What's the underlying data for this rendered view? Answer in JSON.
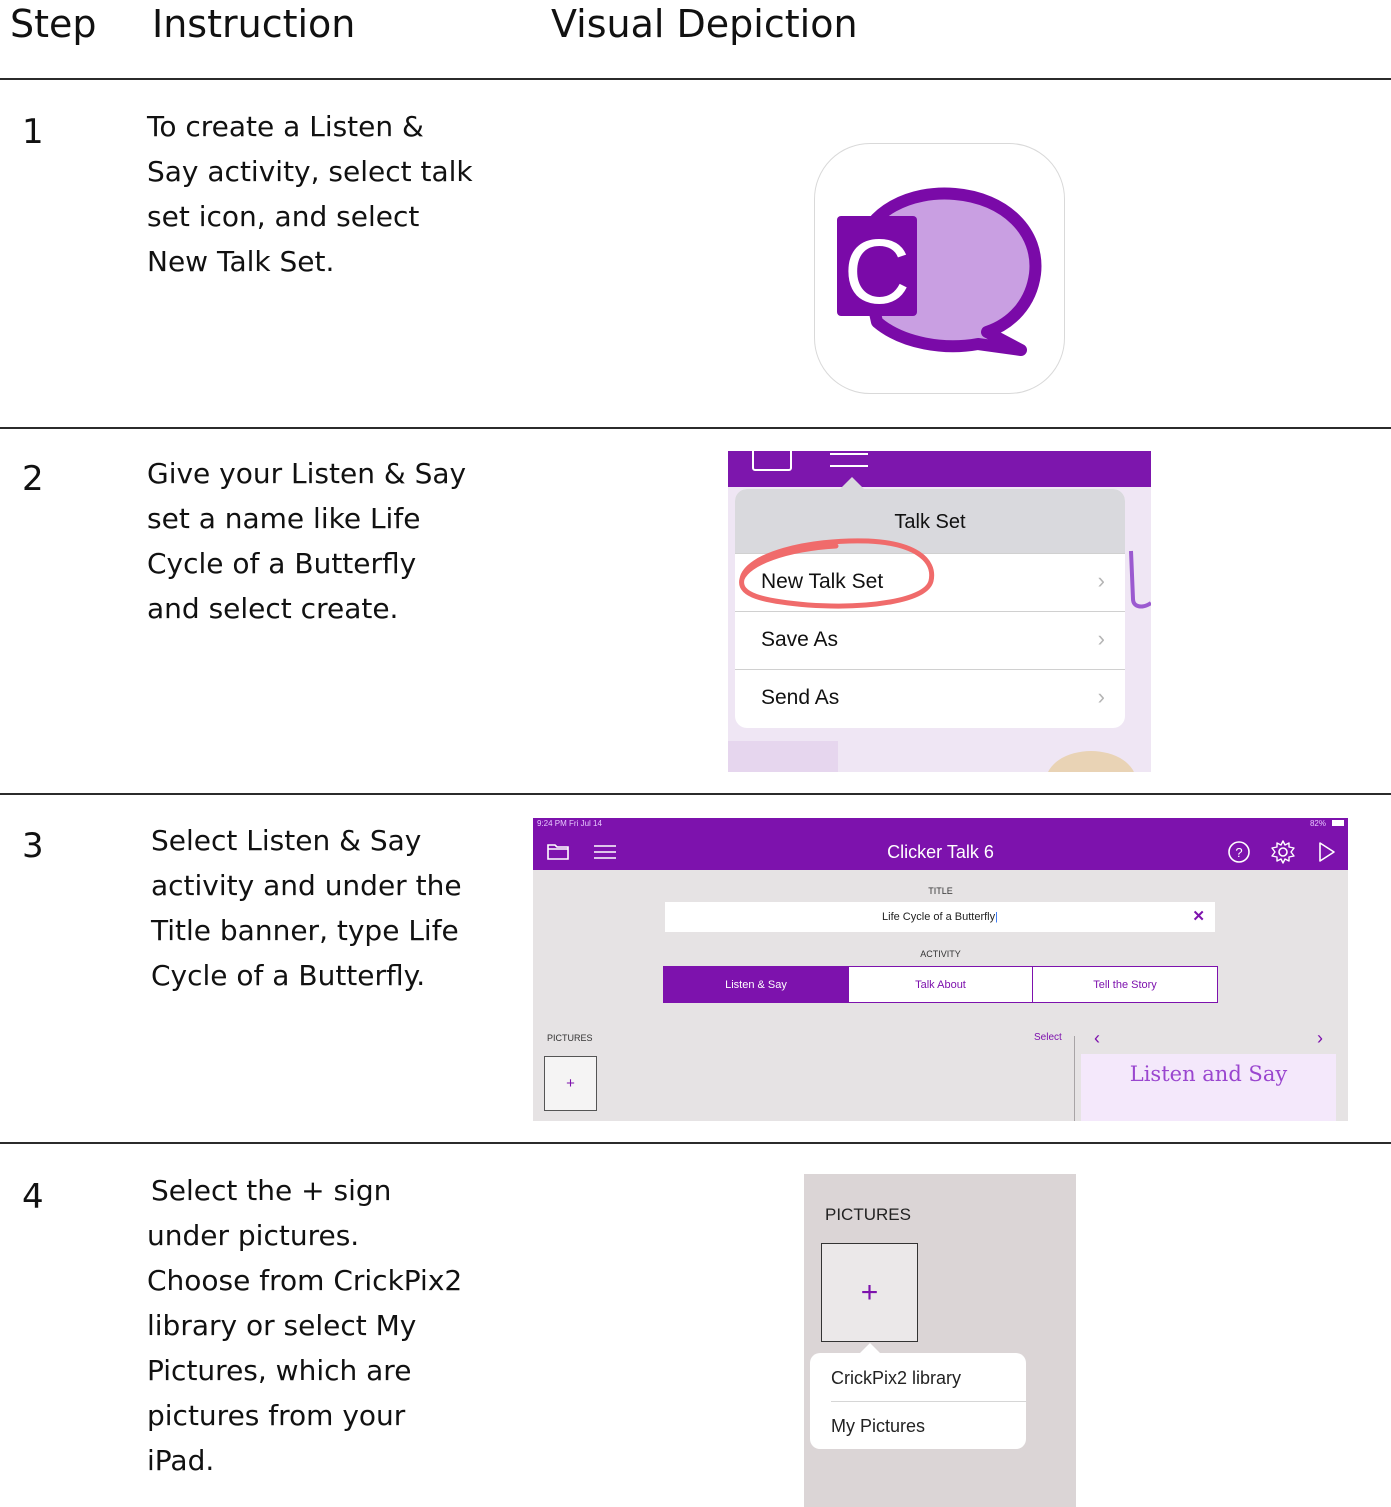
{
  "headers": {
    "step": "Step",
    "instruction": "Instruction",
    "visual": "Visual Depiction"
  },
  "rows": [
    {
      "step": "1",
      "lines": [
        "To create a Listen &",
        "Say activity, select talk",
        "set icon, and select",
        "New Talk Set."
      ]
    },
    {
      "step": "2",
      "lines": [
        "Give your Listen & Say",
        "set a name like Life",
        "Cycle of a Butterfly",
        "and select create."
      ]
    },
    {
      "step": "3",
      "lines": [
        "Select Listen & Say",
        "activity and under the",
        "Title banner, type Life",
        "Cycle of a Butterfly."
      ]
    },
    {
      "step": "4",
      "lines": [
        "Select the + sign",
        "under pictures.",
        "Choose from CrickPix2",
        "library or select My",
        "Pictures, which are",
        "pictures from your",
        "iPad."
      ]
    }
  ],
  "menu": {
    "header": "Talk Set",
    "items": [
      "New Talk Set",
      "Save As",
      "Send As"
    ],
    "highlight_color": "#f06b6b"
  },
  "clicker": {
    "status_left": "9:24 PM   Fri Jul 14",
    "status_right": "82%",
    "app_title": "Clicker Talk 6",
    "title_label": "TITLE",
    "title_value": "Life Cycle of a Butterfly",
    "activity_label": "ACTIVITY",
    "tabs": [
      "Listen & Say",
      "Talk About",
      "Tell the Story"
    ],
    "pictures_label": "PICTURES",
    "select_label": "Select",
    "card_title": "Listen and Say",
    "plus": "+"
  },
  "pictures_popup": {
    "label": "PICTURES",
    "plus": "+",
    "options": [
      "CrickPix2 library",
      "My Pictures"
    ]
  },
  "colors": {
    "brand_purple": "#7d12ad",
    "speech_light": "#c99fe2",
    "speech_dark": "#7a0aa8"
  },
  "icons": {
    "row1": "clicker-talk-app-icon",
    "folder": "folder-icon",
    "menu": "hamburger-menu-icon",
    "help": "help-icon",
    "settings": "gear-icon",
    "play": "play-icon",
    "chevron": "chevron-right-icon"
  }
}
